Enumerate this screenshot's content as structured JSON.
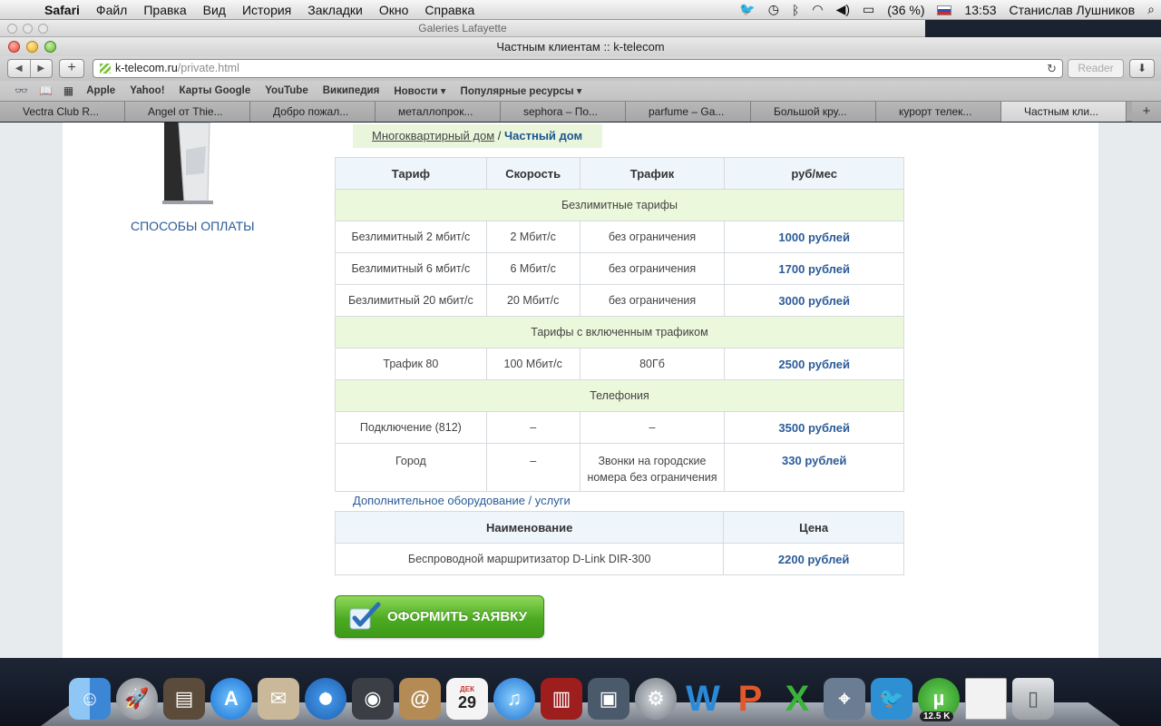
{
  "menubar": {
    "app": "Safari",
    "items": [
      "Файл",
      "Правка",
      "Вид",
      "История",
      "Закладки",
      "Окно",
      "Справка"
    ],
    "battery": "(36 %)",
    "time": "13:53",
    "user": "Станислав Лушников"
  },
  "window": {
    "background_title": "Galeries Lafayette",
    "title": "Частным клиентам :: k-telecom"
  },
  "toolbar": {
    "url_host": "k-telecom.ru",
    "url_path": "/private.html",
    "reader_label": "Reader"
  },
  "bookmarks": [
    "Apple",
    "Yahoo!",
    "Карты Google",
    "YouTube",
    "Википедия",
    "Новости",
    "Популярные ресурсы"
  ],
  "tabs": [
    {
      "label": "Vectra Club R..."
    },
    {
      "label": "Angel от Thie..."
    },
    {
      "label": "Добро пожал..."
    },
    {
      "label": "металлопрок..."
    },
    {
      "label": "sephora – По..."
    },
    {
      "label": "parfume – Ga..."
    },
    {
      "label": "Большой кру..."
    },
    {
      "label": "курорт телек..."
    },
    {
      "label": "Частным кли...",
      "active": true
    }
  ],
  "page": {
    "payment_link": "СПОСОБЫ ОПЛАТЫ",
    "switch_apartment": "Многоквартирный дом",
    "switch_separator": " / ",
    "switch_private": "Частный дом",
    "tariff_headers": {
      "tariff": "Тариф",
      "speed": "Скорость",
      "traffic": "Трафик",
      "price": "руб/мес"
    },
    "group_unlimited": "Безлимитные тарифы",
    "unlimited": [
      {
        "name": "Безлимитный 2 мбит/с",
        "speed": "2 Мбит/с",
        "traffic": "без ограничения",
        "price": "1000 рублей"
      },
      {
        "name": "Безлимитный 6 мбит/с",
        "speed": "6 Мбит/с",
        "traffic": "без ограничения",
        "price": "1700 рублей"
      },
      {
        "name": "Безлимитный 20 мбит/с",
        "speed": "20 Мбит/с",
        "traffic": "без ограничения",
        "price": "3000 рублей"
      }
    ],
    "group_traffic": "Тарифы с включенным трафиком",
    "traffic_plans": [
      {
        "name": "Трафик 80",
        "speed": "100 Мбит/с",
        "traffic": "80Гб",
        "price": "2500 рублей"
      }
    ],
    "group_phone": "Телефония",
    "phone": [
      {
        "name": "Подключение (812)",
        "speed": "–",
        "traffic": "–",
        "price": "3500 рублей"
      },
      {
        "name": "Город",
        "speed": "–",
        "traffic": "Звонки на городские номера без ограничения",
        "price": "330 рублей"
      }
    ],
    "extra_link": "Дополнительное оборудование / услуги",
    "equip_headers": {
      "name": "Наименование",
      "price": "Цена"
    },
    "equipment": [
      {
        "name": "Беспроводной маршритизатор D-Link DIR-300",
        "price": "2200 рублей"
      }
    ],
    "order_button": "ОФОРМИТЬ ЗАЯВКУ"
  },
  "dock": {
    "calendar_month": "ДЕК",
    "calendar_day": "29",
    "utorrent_badge": "12.5 K"
  },
  "colors": {
    "link": "#2a5b98",
    "group_bg": "#ecf8dc",
    "header_bg": "#eef5fb",
    "button_green": "#4caa22"
  }
}
